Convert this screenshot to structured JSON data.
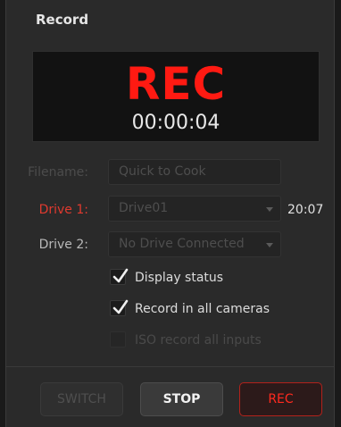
{
  "panel": {
    "title": "Record"
  },
  "display": {
    "rec_label": "REC",
    "timecode": "00:00:04",
    "rec_color": "#ff1a12"
  },
  "filename": {
    "label": "Filename:",
    "value": "Quick to Cook"
  },
  "drive1": {
    "label": "Drive 1:",
    "value": "Drive01",
    "remaining": "20:07"
  },
  "drive2": {
    "label": "Drive 2:",
    "value": "No Drive Connected"
  },
  "options": {
    "display_status": {
      "label": "Display status",
      "checked": true
    },
    "record_all_cameras": {
      "label": "Record in all cameras",
      "checked": true
    },
    "iso_record": {
      "label": "ISO record all inputs",
      "checked": false,
      "enabled": false
    }
  },
  "buttons": {
    "switch": "SWITCH",
    "stop": "STOP",
    "rec": "REC"
  }
}
